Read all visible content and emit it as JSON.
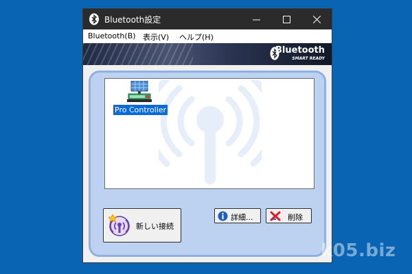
{
  "window": {
    "title": "Bluetooth設定",
    "controls": {
      "minimize": "—",
      "maximize": "☐",
      "close": "✕"
    }
  },
  "menubar": {
    "items": [
      {
        "label": "Bluetooth(B)"
      },
      {
        "label": "表示(V)"
      },
      {
        "label": "ヘルプ(H)"
      }
    ]
  },
  "banner": {
    "brand": "Bluetooth",
    "tagline": "SMART READY",
    "logo_icon": "bluetooth-icon"
  },
  "devices": [
    {
      "name": "Pro Controller",
      "icon": "computer-device-icon",
      "selected": true
    }
  ],
  "buttons": {
    "new_connection": {
      "label": "新しい接続",
      "icon": "new-connection-icon"
    },
    "details": {
      "label": "詳細...",
      "icon": "info-icon"
    },
    "remove": {
      "label": "削除",
      "icon": "delete-x-icon"
    }
  },
  "watermark": {
    "site": "k05.biz"
  },
  "colors": {
    "desktop": "#0a64b4",
    "panel": "#bcd2f0",
    "selection": "#0b6ad6",
    "titlebar": "#2b2b2b"
  }
}
